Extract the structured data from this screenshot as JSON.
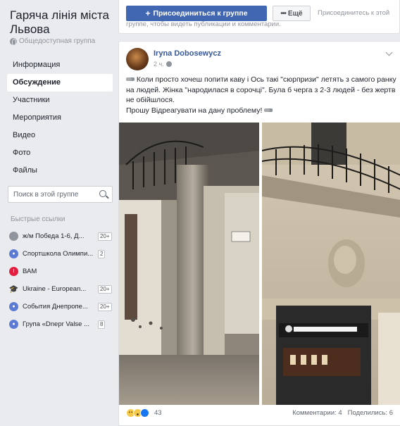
{
  "group": {
    "title": "Гаряча лінія міста Львова",
    "privacy": "Общедоступная группа"
  },
  "nav": {
    "items": [
      {
        "label": "Информация"
      },
      {
        "label": "Обсуждение"
      },
      {
        "label": "Участники"
      },
      {
        "label": "Мероприятия"
      },
      {
        "label": "Видео"
      },
      {
        "label": "Фото"
      },
      {
        "label": "Файлы"
      }
    ],
    "active_index": 1
  },
  "search": {
    "placeholder": "Поиск в этой группе"
  },
  "quick_links": {
    "title": "Быстрые ссылки",
    "items": [
      {
        "label": "ж/м Победа 1-6, Д...",
        "badge": "20+",
        "icon": "moth-icon",
        "color": "#90949c"
      },
      {
        "label": "Спортшкола Олимпи...",
        "badge": "2",
        "icon": "group-icon",
        "color": "#5b7bd5"
      },
      {
        "label": "ВАМ",
        "badge": "",
        "icon": "alert-icon",
        "color": "#e41e3f"
      },
      {
        "label": "Ukraine - European...",
        "badge": "20+",
        "icon": "graduation-cap-icon",
        "color": "#1d2129"
      },
      {
        "label": "События Днепропе...",
        "badge": "20+",
        "icon": "group-icon",
        "color": "#5b7bd5"
      },
      {
        "label": "Група «Dnepr Valse ...",
        "badge": "8",
        "icon": "group-icon",
        "color": "#5b7bd5"
      }
    ]
  },
  "join_card": {
    "join_label": "Присоединиться к группе",
    "more_label": "Ещё",
    "note": "Присоединитесь к этой группе, чтобы видеть публикации и комментарии."
  },
  "post": {
    "author": "Iryna Dobosewycz",
    "time": "2 ч.",
    "lines": [
      "Коли просто хочеш попити каву і Ось такі \"сюрпризи\" летять з самого ранку на людей. Жінка \"народилася в сорочці\". Була б черга з 2-3 людей - без жертв не обійшлося.",
      "Прошу Відреагувати на дану проблему!"
    ],
    "reactions_count": "43",
    "comments": "Комментарии: 4",
    "shares": "Поделились: 6"
  },
  "colors": {
    "brand": "#4267b2",
    "link": "#385898",
    "page_bg": "#e9ebee"
  }
}
